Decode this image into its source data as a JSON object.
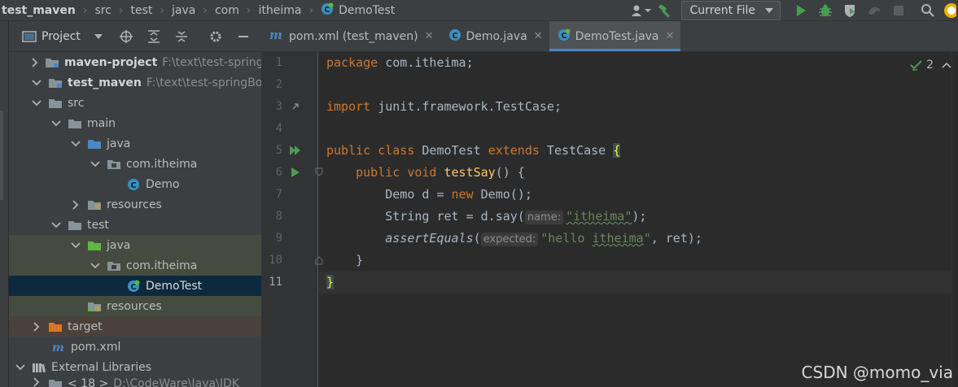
{
  "navbar": {
    "breadcrumbs": [
      "test_maven",
      "src",
      "test",
      "java",
      "com",
      "itheima",
      "DemoTest"
    ],
    "run_config": "Current File"
  },
  "project_panel": {
    "title": "Project"
  },
  "tree": [
    {
      "label": "maven-project",
      "path": "F:\\text\\test-springBoot\\maven-project",
      "bold": true
    },
    {
      "label": "test_maven",
      "path": "F:\\text\\test-springBoot\\test_maven",
      "bold": true
    },
    {
      "label": "src"
    },
    {
      "label": "main"
    },
    {
      "label": "java"
    },
    {
      "label": "com.itheima"
    },
    {
      "label": "Demo"
    },
    {
      "label": "resources"
    },
    {
      "label": "test"
    },
    {
      "label": "java"
    },
    {
      "label": "com.itheima"
    },
    {
      "label": "DemoTest"
    },
    {
      "label": "resources"
    },
    {
      "label": "target"
    },
    {
      "label": "pom.xml"
    },
    {
      "label": "External Libraries"
    },
    {
      "label": "< 18 >",
      "path": "D:\\CodeWare\\Java\\JDK"
    }
  ],
  "tabs": [
    {
      "label": "pom.xml (test_maven)",
      "active": false
    },
    {
      "label": "Demo.java",
      "active": false
    },
    {
      "label": "DemoTest.java",
      "active": true
    }
  ],
  "editor": {
    "line_numbers": [
      "1",
      "2",
      "3",
      "4",
      "5",
      "6",
      "7",
      "8",
      "9",
      "10",
      "11"
    ],
    "inspection_count": "2",
    "code": {
      "l1_kw": "package",
      "l1_rest": " com.itheima;",
      "l3_kw": "import",
      "l3_rest": " junit.framework.TestCase;",
      "l5_kw1": "public class",
      "l5_name": " DemoTest ",
      "l5_kw2": "extends",
      "l5_rest": " TestCase ",
      "l5_brace": "{",
      "l6_indent": "    ",
      "l6_kw": "public void",
      "l6_sp": " ",
      "l6_fn": "testSay",
      "l6_rest": "() {",
      "l7_indent": "        ",
      "l7_a": "Demo d = ",
      "l7_kw": "new",
      "l7_b": " Demo();",
      "l8_indent": "        ",
      "l8_a": "String ret = d.say(",
      "l8_hint": "name:",
      "l8_str": "\"itheima\"",
      "l8_b": ");",
      "l9_indent": "        ",
      "l9_fn": "assertEquals",
      "l9_a": "(",
      "l9_hint": "expected:",
      "l9_str1": "\"hello ",
      "l9_str2": "itheima",
      "l9_str3": "\"",
      "l9_b": ", ret);",
      "l10_indent": "    ",
      "l10_a": "}",
      "l11_a": "}"
    }
  },
  "watermark": "CSDN @momo_via"
}
